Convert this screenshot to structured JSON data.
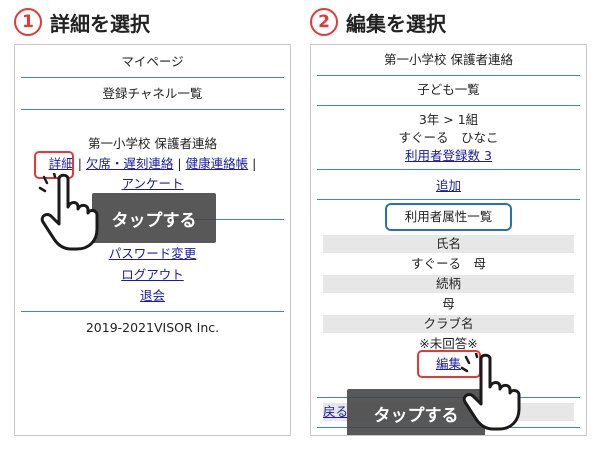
{
  "steps": [
    {
      "number": "1",
      "title": "詳細を選択"
    },
    {
      "number": "2",
      "title": "編集を選択"
    }
  ],
  "screen1": {
    "mypage": "マイページ",
    "channel_list": "登録チャネル一覧",
    "school": "第一小学校 保護者連絡",
    "links": [
      "詳細",
      "欠席・遅刻連絡",
      "健康連絡帳",
      "アンケート"
    ],
    "separator": "|",
    "password": "パスワード変更",
    "logout": "ログアウト",
    "withdraw": "退会",
    "footer": "2019-2021VISOR Inc.",
    "tap_label": "タップする"
  },
  "screen2": {
    "school": "第一小学校 保護者連絡",
    "children": "子ども一覧",
    "grade": "3年 > 1組",
    "child_name": "すぐーる　ひなこ",
    "user_count": "利用者登録数 3",
    "add": "追加",
    "attr_list": "利用者属性一覧",
    "name_label": "氏名",
    "name_value": "すぐーる　母",
    "relation_label": "続柄",
    "relation_value": "母",
    "club_label": "クラブ名",
    "club_value": "※未回答※",
    "edit": "編集",
    "back": "戻る",
    "tap_label": "タップする"
  }
}
